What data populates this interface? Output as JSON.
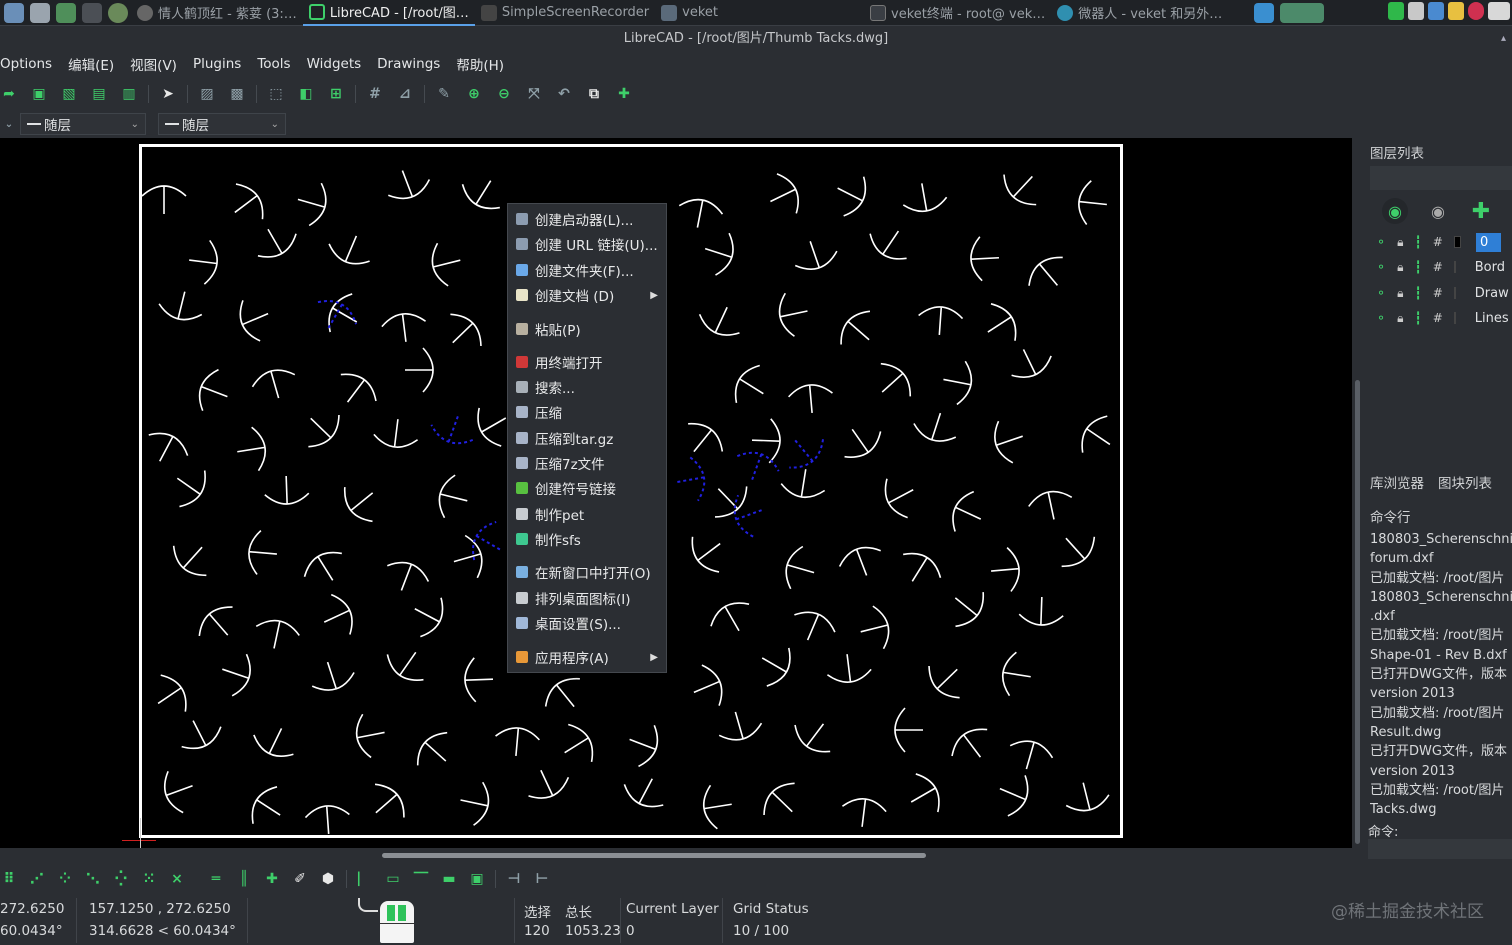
{
  "taskbar": {
    "tasks": [
      {
        "label": "情人鹤顶红 - 紫荽 (3:…",
        "active": false
      },
      {
        "label": "LibreCAD - [/root/图…",
        "active": true
      },
      {
        "label": "SimpleScreenRecorder",
        "active": false
      },
      {
        "label": "veket",
        "active": false
      },
      {
        "label": "veket终端 - root@ vek…",
        "active": false
      },
      {
        "label": "微器人 - veket 和另外…",
        "active": false
      }
    ]
  },
  "window": {
    "title": "LibreCAD - [/root/图片/Thumb Tacks.dwg]",
    "restore_glyph": "▴"
  },
  "menu": [
    "Options",
    "编辑(E)",
    "视图(V)",
    "Plugins",
    "Tools",
    "Widgets",
    "Drawings",
    "帮助(H)"
  ],
  "layer_bar": {
    "pen": "随层",
    "linetype": "随层"
  },
  "context_menu": {
    "items": [
      {
        "label": "创建启动器(L)...",
        "icon": "launcher-icon",
        "color": "#8c9cb0",
        "submenu": false
      },
      {
        "label": "创建 URL 链接(U)...",
        "icon": "link-icon",
        "color": "#8c9cb0",
        "submenu": false
      },
      {
        "label": "创建文件夹(F)...",
        "icon": "folder-icon",
        "color": "#6aa8e8",
        "submenu": false
      },
      {
        "label": "创建文档 (D)",
        "icon": "document-icon",
        "color": "#e8e4c8",
        "submenu": true
      },
      {
        "label": "粘贴(P)",
        "icon": "paste-icon",
        "color": "#b8b0a0",
        "submenu": false
      },
      {
        "label": "用终端打开",
        "icon": "terminal-icon",
        "color": "#d03838",
        "submenu": false
      },
      {
        "label": "搜索...",
        "icon": "search-share-icon",
        "color": "#a8b0b8",
        "submenu": false
      },
      {
        "label": "压缩",
        "icon": "archive-icon",
        "color": "#a8b4c8",
        "submenu": false
      },
      {
        "label": "压缩到tar.gz",
        "icon": "archive-targz-icon",
        "color": "#a8b4c8",
        "submenu": false
      },
      {
        "label": "压缩7z文件",
        "icon": "archive-7z-icon",
        "color": "#a8b4c8",
        "submenu": false
      },
      {
        "label": "创建符号链接",
        "icon": "symlink-icon",
        "color": "#58c040",
        "submenu": false
      },
      {
        "label": "制作pet",
        "icon": "pet-icon",
        "color": "#c8ccd0",
        "submenu": false
      },
      {
        "label": "制作sfs",
        "icon": "sfs-icon",
        "color": "#3ec890",
        "submenu": false
      },
      {
        "label": "在新窗口中打开(O)",
        "icon": "new-window-icon",
        "color": "#7ab0e0",
        "submenu": false
      },
      {
        "label": "排列桌面图标(I)",
        "icon": "arrange-icon",
        "color": "#c8ccd0",
        "submenu": false
      },
      {
        "label": "桌面设置(S)...",
        "icon": "desktop-settings-icon",
        "color": "#a0b8d8",
        "submenu": false
      },
      {
        "label": "应用程序(A)",
        "icon": "applications-icon",
        "color": "#e89838",
        "submenu": true
      }
    ]
  },
  "layer_list": {
    "title": "图层列表",
    "layers": [
      {
        "name": "0",
        "selected": true
      },
      {
        "name": "Bord",
        "selected": false
      },
      {
        "name": "Draw",
        "selected": false
      },
      {
        "name": "Lines",
        "selected": false
      }
    ]
  },
  "dock_tabs": [
    "库浏览器",
    "图块列表"
  ],
  "command": {
    "title": "命令行",
    "log": [
      "180803_Scherenschni",
      "forum.dxf",
      "已加载文档: /root/图片",
      "180803_Scherenschni",
      ".dxf",
      "已加载文档: /root/图片",
      "Shape-01 - Rev B.dxf",
      "已打开DWG文件，版本",
      "version 2013",
      "已加载文档: /root/图片",
      "Result.dwg",
      "已打开DWG文件，版本",
      "version 2013",
      "已加载文档: /root/图片",
      "Tacks.dwg"
    ],
    "prompt": "命令:"
  },
  "status": {
    "abs_coord": "272.6250",
    "abs_polar": "60.0434°",
    "rel_coord": "157.1250 , 272.6250",
    "rel_polar": "314.6628 < 60.0434°",
    "select_label": "选择",
    "select_value": "120",
    "total_label": "总长",
    "total_value": "1053.23",
    "layer_label": "Current Layer",
    "layer_value": "0",
    "grid_label": "Grid Status",
    "grid_value": "10 / 100"
  },
  "watermark": "@稀土掘金技术社区",
  "colors": {
    "accent": "#2f7fd6",
    "green": "#3ecf6a",
    "canvas": "#000000",
    "selection_blue": "#2020e0"
  }
}
